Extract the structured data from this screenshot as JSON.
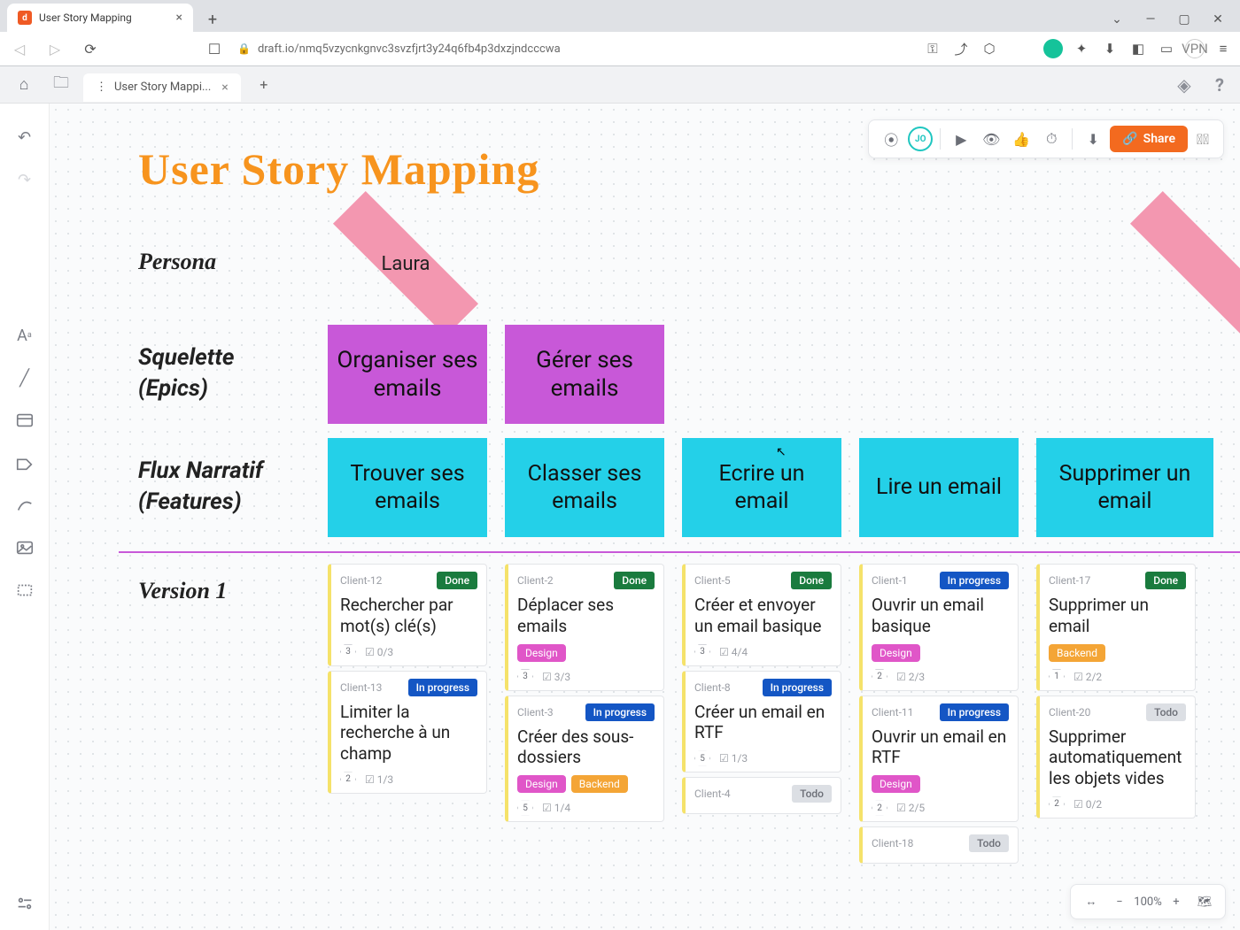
{
  "browser": {
    "tab_title": "User Story Mapping",
    "url": "draft.io/nmq5vzycnkgnvc3svzfjrt3y24q6fb4p3dxzjndcccwa",
    "vpn_label": "VPN"
  },
  "toolbar": {
    "doc_tab": "User Story Mappi...",
    "avatar_initials": "JO",
    "share_label": "Share"
  },
  "zoom": {
    "value": "100%",
    "fit_icon": "↔"
  },
  "map": {
    "title": "User Story Mapping",
    "labels": {
      "persona": "Persona",
      "epics_line1": "Squelette",
      "epics_line2": "(Epics)",
      "features_line1": "Flux Narratif",
      "features_line2": "(Features)",
      "version": "Version 1"
    },
    "persona": "Laura",
    "epics": [
      "Organiser ses emails",
      "Gérer ses emails"
    ],
    "features": [
      "Trouver ses emails",
      "Classer ses emails",
      "Ecrire un email",
      "Lire un email",
      "Supprimer un email"
    ]
  },
  "columns": [
    [
      {
        "client": "Client-12",
        "status": "Done",
        "title": "Rechercher par mot(s) clé(s)",
        "tags": [],
        "effort": "3",
        "ratio": "0/3"
      },
      {
        "client": "Client-13",
        "status": "In progress",
        "title": "Limiter la recherche à un champ",
        "tags": [],
        "effort": "2",
        "ratio": "1/3"
      }
    ],
    [
      {
        "client": "Client-2",
        "status": "Done",
        "title": "Déplacer ses emails",
        "tags": [
          "Design"
        ],
        "effort": "3",
        "ratio": "3/3"
      },
      {
        "client": "Client-3",
        "status": "In progress",
        "title": "Créer des sous-dossiers",
        "tags": [
          "Design",
          "Backend"
        ],
        "effort": "5",
        "ratio": "1/4"
      }
    ],
    [
      {
        "client": "Client-5",
        "status": "Done",
        "title": "Créer et envoyer un email basique",
        "tags": [],
        "effort": "3",
        "ratio": "4/4"
      },
      {
        "client": "Client-8",
        "status": "In progress",
        "title": "Créer un email en RTF",
        "tags": [],
        "effort": "5",
        "ratio": "1/3"
      },
      {
        "client": "Client-4",
        "status": "Todo",
        "title": "",
        "tags": [],
        "effort": "",
        "ratio": ""
      }
    ],
    [
      {
        "client": "Client-1",
        "status": "In progress",
        "title": "Ouvrir un email basique",
        "tags": [
          "Design"
        ],
        "effort": "2",
        "ratio": "2/3"
      },
      {
        "client": "Client-11",
        "status": "In progress",
        "title": "Ouvrir un email en RTF",
        "tags": [
          "Design"
        ],
        "effort": "2",
        "ratio": "2/5"
      },
      {
        "client": "Client-18",
        "status": "Todo",
        "title": "",
        "tags": [],
        "effort": "",
        "ratio": ""
      }
    ],
    [
      {
        "client": "Client-17",
        "status": "Done",
        "title": "Supprimer un email",
        "tags": [
          "Backend"
        ],
        "effort": "1",
        "ratio": "2/2"
      },
      {
        "client": "Client-20",
        "status": "Todo",
        "title": "Supprimer automatiquement les objets vides",
        "tags": [],
        "effort": "2",
        "ratio": "0/2"
      }
    ]
  ],
  "status_labels": {
    "Done": "Done",
    "In progress": "In progress",
    "Todo": "Todo"
  },
  "tag_labels": {
    "Design": "Design",
    "Backend": "Backend"
  }
}
